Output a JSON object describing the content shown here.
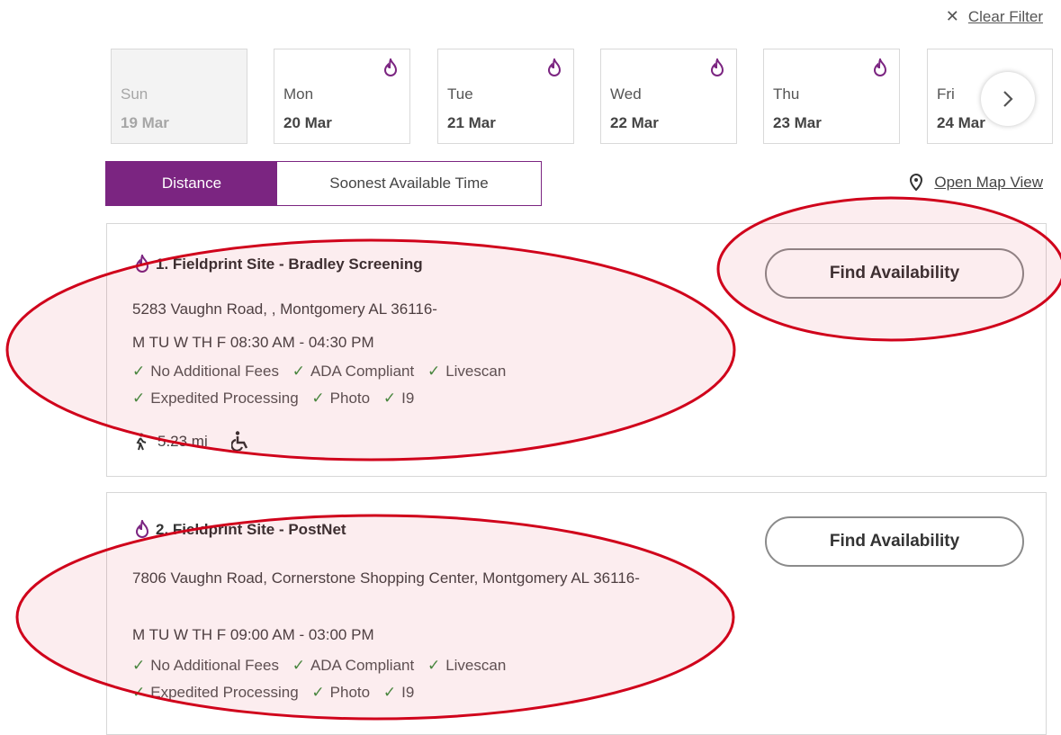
{
  "header": {
    "clear_filter_label": "Clear Filter"
  },
  "days": [
    {
      "name": "Sun",
      "date": "19 Mar",
      "available": false
    },
    {
      "name": "Mon",
      "date": "20 Mar",
      "available": true
    },
    {
      "name": "Tue",
      "date": "21 Mar",
      "available": true
    },
    {
      "name": "Wed",
      "date": "22 Mar",
      "available": true
    },
    {
      "name": "Thu",
      "date": "23 Mar",
      "available": true
    },
    {
      "name": "Fri",
      "date": "24 Mar",
      "available": true
    }
  ],
  "sort": {
    "distance_label": "Distance",
    "soonest_label": "Soonest Available Time",
    "selected": "Distance"
  },
  "map": {
    "open_map_label": "Open Map View"
  },
  "locations": [
    {
      "title": "1. Fieldprint Site - Bradley Screening",
      "address": "5283 Vaughn Road, , Montgomery AL 36116-",
      "hours": "M TU W TH F 08:30 AM - 04:30 PM",
      "features_row1": [
        "No Additional Fees",
        "ADA Compliant",
        "Livescan"
      ],
      "features_row2": [
        "Expedited Processing",
        "Photo",
        "I9"
      ],
      "distance": "5.23 mi",
      "button_label": "Find Availability"
    },
    {
      "title": "2. Fieldprint Site - PostNet",
      "address": "7806 Vaughn Road, Cornerstone Shopping Center, Montgomery AL 36116-",
      "hours": "M TU W TH F 09:00 AM - 03:00 PM",
      "features_row1": [
        "No Additional Fees",
        "ADA Compliant",
        "Livescan"
      ],
      "features_row2": [
        "Expedited Processing",
        "Photo",
        "I9"
      ],
      "button_label": "Find Availability"
    }
  ],
  "colors": {
    "brand": "#7b2581",
    "check": "#3f9142",
    "annotation": "#d0021b"
  }
}
